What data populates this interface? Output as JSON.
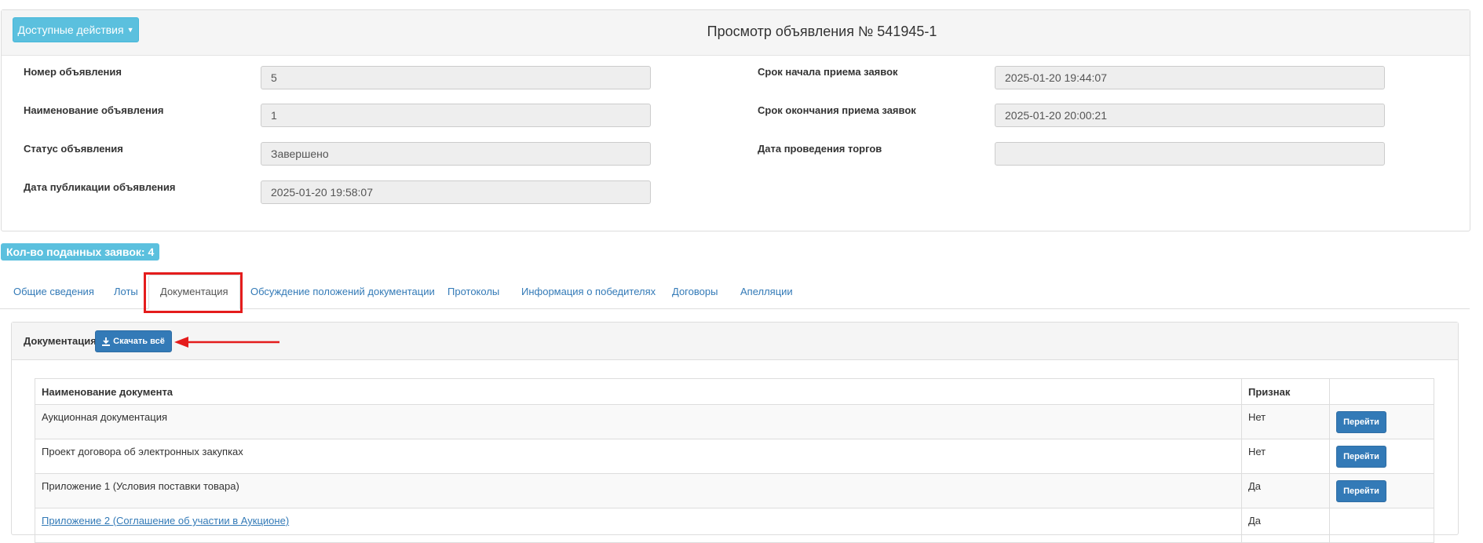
{
  "header": {
    "actions_label": "Доступные действия",
    "title": "Просмотр объявления № 541945-1"
  },
  "fields_left": [
    {
      "label": "Номер объявления",
      "value": "5"
    },
    {
      "label": "Наименование объявления",
      "value": "1"
    },
    {
      "label": "Статус объявления",
      "value": "Завершено"
    },
    {
      "label": "Дата публикации объявления",
      "value": "2025-01-20 19:58:07"
    }
  ],
  "fields_right": [
    {
      "label": "Срок начала приема заявок",
      "value": "2025-01-20 19:44:07"
    },
    {
      "label": "Срок окончания приема заявок",
      "value": "2025-01-20 20:00:21"
    },
    {
      "label": "Дата проведения торгов",
      "value": ""
    }
  ],
  "applications_badge": "Кол-во поданных заявок: 4",
  "tabs": [
    {
      "label": "Общие сведения"
    },
    {
      "label": "Лоты"
    },
    {
      "label": "Документация"
    },
    {
      "label": "Обсуждение положений документации"
    },
    {
      "label": "Протоколы"
    },
    {
      "label": "Информация о победителях"
    },
    {
      "label": "Договоры"
    },
    {
      "label": "Апелляции"
    }
  ],
  "active_tab": "Документация",
  "documents_panel": {
    "title": "Документация",
    "download_all_label": "Скачать всё",
    "columns": [
      "Наименование документа",
      "Признак",
      ""
    ],
    "rows": [
      {
        "name": "Аукционная документация",
        "flag": "Нет",
        "action": "Перейти"
      },
      {
        "name": "Проект договора об электронных закупках",
        "flag": "Нет",
        "action": "Перейти"
      },
      {
        "name": "Приложение 1 (Условия поставки товара)",
        "flag": "Да",
        "action": "Перейти"
      },
      {
        "name": "Приложение 2 (Соглашение об участии в Аукционе)",
        "flag": "Да",
        "action": ""
      }
    ]
  },
  "colors": {
    "info": "#5bc0de",
    "primary": "#337ab7",
    "highlight": "#e41c1c"
  },
  "icons": {
    "actions_dropdown": "caret-down-icon",
    "download": "download-icon",
    "annotation": "red-arrow-icon"
  }
}
